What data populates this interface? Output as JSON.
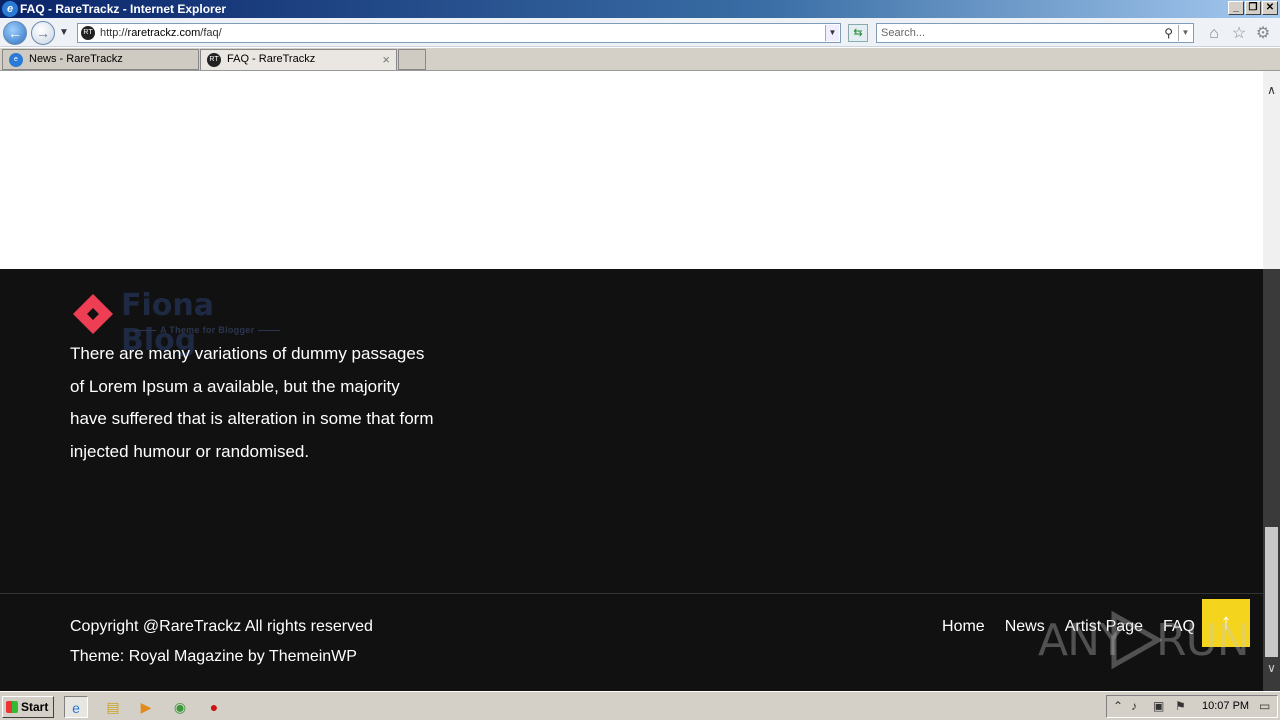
{
  "window": {
    "title": "FAQ - RareTrackz - Internet Explorer",
    "ie_logo": "e",
    "buttons": {
      "minimize": "_",
      "restore": "❐",
      "close": "✕"
    }
  },
  "navbar": {
    "back_glyph": "←",
    "forward_glyph": "→",
    "address_favicon": "RT",
    "address_url_prefix": "http://",
    "address_url_host": "raretrackz.com",
    "address_url_path": "/faq/",
    "search_placeholder": "Search...",
    "icons": [
      "home-icon",
      "star-icon",
      "gear-icon"
    ]
  },
  "tabs": [
    {
      "label": "News - RareTrackz",
      "active": false,
      "icon": "ie-icon"
    },
    {
      "label": "FAQ - RareTrackz",
      "active": true,
      "icon": "RT",
      "close": "×"
    }
  ],
  "page": {
    "logo": {
      "brand": "Fiona Blog",
      "tagline": "A Theme for Blogger",
      "brand_color": "#1e2a44",
      "mark_color": "#ee3e54"
    },
    "about_text": "There are many variations of dummy passages of Lorem Ipsum a available, but the majority have suffered that is alteration in some that form injected humour or randomised.",
    "copyright": "Copyright @RareTrackz All rights reserved",
    "theme_credit": "Theme: Royal Magazine by ThemeinWP",
    "footer_nav": [
      "Home",
      "News",
      "Artist Page",
      "FAQ"
    ],
    "scroll_top_glyph": "↑",
    "scroll_top_color": "#f5d41e",
    "footer_bg": "#111111"
  },
  "watermark": {
    "text_left": "ANY",
    "text_right": "RUN"
  },
  "taskbar": {
    "start_label": "Start",
    "apps": [
      "ie-icon",
      "explorer-icon",
      "media-icon",
      "chrome-icon",
      "opera-icon"
    ],
    "clock": "10:07 PM"
  }
}
